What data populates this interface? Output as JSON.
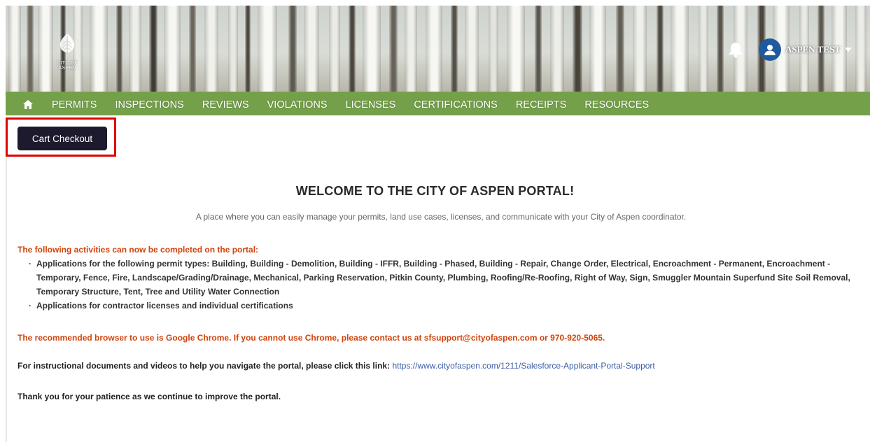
{
  "header": {
    "logo_text": "CITY OF ASPEN",
    "user_name": "ASPEN TEST"
  },
  "nav": {
    "items": [
      {
        "label": "PERMITS"
      },
      {
        "label": "INSPECTIONS"
      },
      {
        "label": "REVIEWS"
      },
      {
        "label": "VIOLATIONS"
      },
      {
        "label": "LICENSES"
      },
      {
        "label": "CERTIFICATIONS"
      },
      {
        "label": "RECEIPTS"
      },
      {
        "label": "RESOURCES"
      }
    ]
  },
  "cart": {
    "button_label": "Cart Checkout"
  },
  "content": {
    "title": "WELCOME TO THE CITY OF ASPEN PORTAL!",
    "tagline": "A place where you can easily manage your permits, land use cases, licenses, and communicate with your City of Aspen coordinator.",
    "activities_heading": "The following activities can now be completed on the portal:",
    "activities": [
      "Applications for the following permit types: Building, Building - Demolition, Building - IFFR, Building - Phased, Building - Repair, Change Order, Electrical, Encroachment - Permanent, Encroachment - Temporary, Fence, Fire, Landscape/Grading/Drainage, Mechanical, Parking Reservation, Pitkin County, Plumbing, Roofing/Re-Roofing, Right of Way, Sign, Smuggler Mountain Superfund Site Soil Removal, Temporary Structure, Tent, Tree and Utility Water Connection",
      "Applications for contractor licenses and individual certifications"
    ],
    "browser_note": "The recommended browser to use is Google Chrome. If you cannot use Chrome, please contact us at sfsupport@cityofaspen.com or 970-920-5065.",
    "instructions_label": "For instructional documents and videos to help you navigate the portal, please click this link:",
    "instructions_link": "https://www.cityofaspen.com/1211/Salesforce-Applicant-Portal-Support",
    "thanks": "Thank you for your patience as we continue to improve the portal."
  },
  "colors": {
    "nav_bg": "#74a04a",
    "button_bg": "#1d1a2d",
    "highlight_border": "#e10000",
    "notice_text": "#d1440c",
    "link": "#3b5fa6",
    "avatar_bg": "#1f5aa0"
  },
  "icons": {
    "home": "home-icon",
    "bell": "bell-icon",
    "user": "user-icon",
    "caret": "caret-down-icon",
    "logo": "aspen-leaf-logo"
  }
}
